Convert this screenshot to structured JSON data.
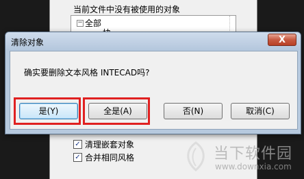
{
  "background_window": {
    "heading": "当前文件中没有被使用的对象",
    "tree": {
      "toggle": "−",
      "root_label": "全部",
      "child_label": "块"
    },
    "options": [
      {
        "label": "清理嵌套对象",
        "checked": true
      },
      {
        "label": "合并相同风格",
        "checked": true
      }
    ]
  },
  "dialog": {
    "title": "清除对象",
    "close_glyph": "X",
    "message": "确实要删除文本风格 INTECAD吗?",
    "buttons": {
      "yes": "是(Y)",
      "yes_all": "全是(A)",
      "no": "否(N)",
      "cancel": "取消(C)"
    }
  },
  "watermark": {
    "brand": "当下软件园",
    "url": "www.downxia.com"
  },
  "colors": {
    "highlight": "#e02020",
    "title_bar": "#b6c9de",
    "close_button": "#c75a41"
  },
  "icons": {
    "checkbox_checked": "check-icon",
    "tree_toggle": "collapse-icon",
    "watermark_logo": "leaf-logo"
  }
}
